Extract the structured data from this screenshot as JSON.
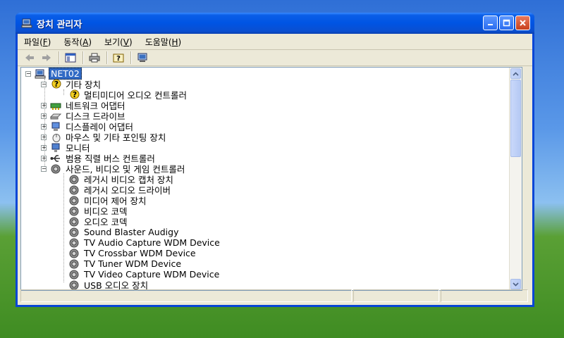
{
  "window": {
    "title": "장치 관리자",
    "title_icon": "computer-icon"
  },
  "menu": [
    {
      "label": "파일(",
      "key": "F",
      "end": ")"
    },
    {
      "label": "동작(",
      "key": "A",
      "end": ")"
    },
    {
      "label": "보기(",
      "key": "V",
      "end": ")"
    },
    {
      "label": "도움말(",
      "key": "H",
      "end": ")"
    }
  ],
  "toolbar": {
    "buttons": [
      "back-arrow-icon",
      "forward-arrow-icon",
      "console-tree-icon",
      "print-icon",
      "help-icon",
      "computer-properties-icon"
    ]
  },
  "tree": {
    "root": "NET02",
    "nodes": [
      {
        "label": "기타 장치",
        "icon": "question-device-icon",
        "state": "expanded"
      },
      {
        "label": "멀티미디어 오디오 컨트롤러",
        "icon": "question-device-icon",
        "state": "leaf"
      },
      {
        "label": "네트워크 어댑터",
        "icon": "network-icon",
        "state": "collapsed"
      },
      {
        "label": "디스크 드라이브",
        "icon": "disk-icon",
        "state": "collapsed"
      },
      {
        "label": "디스플레이 어댑터",
        "icon": "display-icon",
        "state": "collapsed"
      },
      {
        "label": "마우스 및 기타 포인팅 장치",
        "icon": "mouse-icon",
        "state": "collapsed"
      },
      {
        "label": "모니터",
        "icon": "monitor-icon",
        "state": "collapsed"
      },
      {
        "label": "범용 직렬 버스 컨트롤러",
        "icon": "usb-icon",
        "state": "collapsed"
      },
      {
        "label": "사운드, 비디오 및 게임 컨트롤러",
        "icon": "speaker-icon",
        "state": "expanded"
      },
      {
        "label": "레거시 비디오 캡처 장치",
        "icon": "speaker-icon",
        "state": "leaf"
      },
      {
        "label": "레거시 오디오 드라이버",
        "icon": "speaker-icon",
        "state": "leaf"
      },
      {
        "label": "미디어 제어 장치",
        "icon": "speaker-icon",
        "state": "leaf"
      },
      {
        "label": "비디오 코덱",
        "icon": "speaker-icon",
        "state": "leaf"
      },
      {
        "label": "오디오 코덱",
        "icon": "speaker-icon",
        "state": "leaf"
      },
      {
        "label": "Sound Blaster Audigy",
        "icon": "speaker-icon",
        "state": "leaf"
      },
      {
        "label": "TV Audio Capture WDM Device",
        "icon": "speaker-icon",
        "state": "leaf"
      },
      {
        "label": "TV Crossbar WDM Device",
        "icon": "speaker-icon",
        "state": "leaf"
      },
      {
        "label": "TV Tuner WDM Device",
        "icon": "speaker-icon",
        "state": "leaf"
      },
      {
        "label": "TV Video Capture WDM Device",
        "icon": "speaker-icon",
        "state": "leaf"
      },
      {
        "label": "USB 오디오 장치",
        "icon": "speaker-icon",
        "state": "leaf"
      }
    ]
  },
  "colors": {
    "title_bar": "#0054e3",
    "selection": "#316ac5",
    "window_face": "#ece9d8"
  }
}
